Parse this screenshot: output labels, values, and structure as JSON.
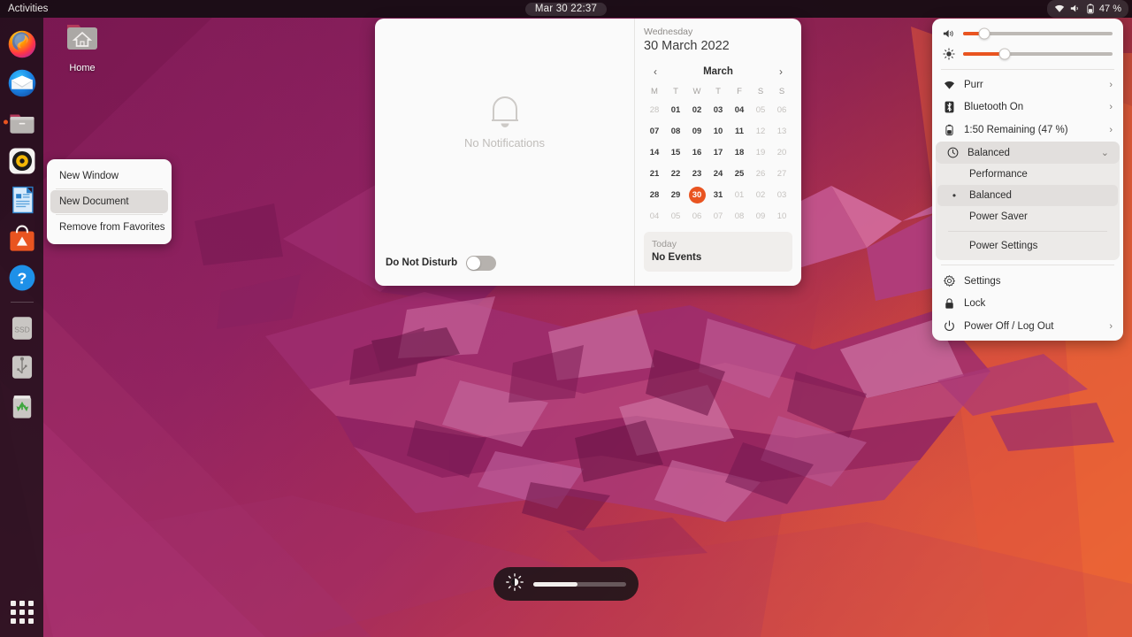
{
  "topbar": {
    "activities_label": "Activities",
    "clock": "Mar 30  22:37",
    "battery_percent_label": "47 %",
    "icons": [
      "wifi-icon",
      "volume-muted-icon",
      "battery-icon"
    ]
  },
  "desktop_icon": {
    "label": "Home",
    "icon": "home-folder-icon"
  },
  "dock": {
    "items": [
      {
        "name": "firefox",
        "label": "Firefox",
        "running": false
      },
      {
        "name": "thunderbird",
        "label": "Thunderbird Mail",
        "running": false
      },
      {
        "name": "files",
        "label": "Files",
        "running": true
      },
      {
        "name": "rhythmbox",
        "label": "Rhythmbox",
        "running": false
      },
      {
        "name": "libreoffice-writer",
        "label": "LibreOffice Writer",
        "running": false
      },
      {
        "name": "ubuntu-software",
        "label": "Ubuntu Software",
        "running": false
      },
      {
        "name": "help",
        "label": "Help",
        "running": false
      }
    ],
    "mounts": [
      {
        "name": "ssd-drive",
        "label": "SSD"
      },
      {
        "name": "usb-drive",
        "label": "USB Drive"
      },
      {
        "name": "trash",
        "label": "Trash"
      }
    ],
    "show_apps_label": "Show Applications"
  },
  "context_menu": {
    "items": [
      {
        "label": "New Window",
        "hovered": false
      },
      {
        "label": "New Document",
        "hovered": true
      },
      {
        "label": "Remove from Favorites",
        "hovered": false
      }
    ]
  },
  "calendar_popup": {
    "notifications": {
      "empty_text": "No Notifications",
      "icon": "bell-icon",
      "do_not_disturb_label": "Do Not Disturb",
      "do_not_disturb_on": false
    },
    "weekday": "Wednesday",
    "full_date": "30 March 2022",
    "month_label": "March",
    "prev_label": "‹",
    "next_label": "›",
    "day_headers": [
      "M",
      "T",
      "W",
      "T",
      "F",
      "S",
      "S"
    ],
    "weeks": [
      [
        {
          "d": "28",
          "dim": true,
          "today": false
        },
        {
          "d": "01",
          "dim": false,
          "today": false
        },
        {
          "d": "02",
          "dim": false,
          "today": false
        },
        {
          "d": "03",
          "dim": false,
          "today": false
        },
        {
          "d": "04",
          "dim": false,
          "today": false
        },
        {
          "d": "05",
          "dim": true,
          "today": false
        },
        {
          "d": "06",
          "dim": true,
          "today": false
        }
      ],
      [
        {
          "d": "07",
          "dim": false,
          "today": false
        },
        {
          "d": "08",
          "dim": false,
          "today": false
        },
        {
          "d": "09",
          "dim": false,
          "today": false
        },
        {
          "d": "10",
          "dim": false,
          "today": false
        },
        {
          "d": "11",
          "dim": false,
          "today": false
        },
        {
          "d": "12",
          "dim": true,
          "today": false
        },
        {
          "d": "13",
          "dim": true,
          "today": false
        }
      ],
      [
        {
          "d": "14",
          "dim": false,
          "today": false
        },
        {
          "d": "15",
          "dim": false,
          "today": false
        },
        {
          "d": "16",
          "dim": false,
          "today": false
        },
        {
          "d": "17",
          "dim": false,
          "today": false
        },
        {
          "d": "18",
          "dim": false,
          "today": false
        },
        {
          "d": "19",
          "dim": true,
          "today": false
        },
        {
          "d": "20",
          "dim": true,
          "today": false
        }
      ],
      [
        {
          "d": "21",
          "dim": false,
          "today": false
        },
        {
          "d": "22",
          "dim": false,
          "today": false
        },
        {
          "d": "23",
          "dim": false,
          "today": false
        },
        {
          "d": "24",
          "dim": false,
          "today": false
        },
        {
          "d": "25",
          "dim": false,
          "today": false
        },
        {
          "d": "26",
          "dim": true,
          "today": false
        },
        {
          "d": "27",
          "dim": true,
          "today": false
        }
      ],
      [
        {
          "d": "28",
          "dim": false,
          "today": false
        },
        {
          "d": "29",
          "dim": false,
          "today": false
        },
        {
          "d": "30",
          "dim": false,
          "today": true
        },
        {
          "d": "31",
          "dim": false,
          "today": false
        },
        {
          "d": "01",
          "dim": true,
          "today": false
        },
        {
          "d": "02",
          "dim": true,
          "today": false
        },
        {
          "d": "03",
          "dim": true,
          "today": false
        }
      ],
      [
        {
          "d": "04",
          "dim": true,
          "today": false
        },
        {
          "d": "05",
          "dim": true,
          "today": false
        },
        {
          "d": "06",
          "dim": true,
          "today": false
        },
        {
          "d": "07",
          "dim": true,
          "today": false
        },
        {
          "d": "08",
          "dim": true,
          "today": false
        },
        {
          "d": "09",
          "dim": true,
          "today": false
        },
        {
          "d": "10",
          "dim": true,
          "today": false
        }
      ]
    ],
    "events": {
      "title": "Today",
      "value": "No Events"
    }
  },
  "system_menu": {
    "volume": {
      "icon": "volume-icon",
      "value_percent": 14
    },
    "brightness": {
      "icon": "brightness-icon",
      "value_percent": 28
    },
    "rows": [
      {
        "name": "wifi",
        "icon": "wifi-icon",
        "label": "Purr",
        "chevron": "›"
      },
      {
        "name": "bluetooth",
        "icon": "bluetooth-icon",
        "label": "Bluetooth On",
        "chevron": "›"
      },
      {
        "name": "battery",
        "icon": "battery-icon",
        "label": "1:50 Remaining (47 %)",
        "chevron": "›"
      }
    ],
    "power_profile": {
      "icon": "power-profile-icon",
      "label": "Balanced",
      "chevron": "⌄",
      "expanded": true,
      "options": [
        {
          "label": "Performance",
          "selected": false
        },
        {
          "label": "Balanced",
          "selected": true
        },
        {
          "label": "Power Saver",
          "selected": false
        }
      ],
      "settings_label": "Power Settings"
    },
    "footer": [
      {
        "name": "settings",
        "icon": "gear-icon",
        "label": "Settings",
        "chevron": ""
      },
      {
        "name": "lock",
        "icon": "lock-icon",
        "label": "Lock",
        "chevron": ""
      },
      {
        "name": "power",
        "icon": "power-icon",
        "label": "Power Off / Log Out",
        "chevron": "›"
      }
    ]
  },
  "osd": {
    "icon": "brightness-icon",
    "value_percent": 48
  },
  "colors": {
    "accent": "#e95420",
    "panel_bg": "#fafafa",
    "topbar_bg": "#160c12",
    "wallpaper_magenta": "#8a1f5e",
    "wallpaper_orange": "#e2553a"
  }
}
